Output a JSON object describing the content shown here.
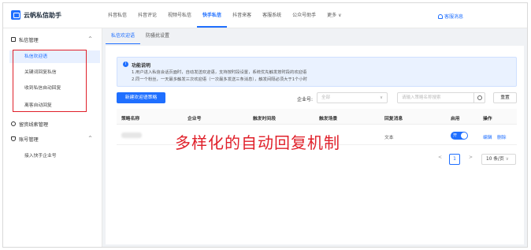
{
  "brand": {
    "name": "云帆私信助手",
    "logo_icon": "chat-app-logo"
  },
  "nav": {
    "items": [
      "抖音私信",
      "抖音评论",
      "视频号私信",
      "快手私信",
      "抖音来客",
      "客服系统",
      "公众号助手"
    ],
    "active": "快手私信",
    "more_label": "更多",
    "messages_label": "客服消息"
  },
  "sidebar": {
    "groups": [
      {
        "label": "私信管理",
        "expanded": true,
        "icon": "message-icon"
      },
      {
        "label": "留资线索管理",
        "icon": "clue-icon"
      },
      {
        "label": "账号管理",
        "expanded": true,
        "icon": "account-icon"
      }
    ],
    "items": [
      "私信欢迎语",
      "关键词回复私信",
      "收到私信自动回复",
      "离客自动回复",
      "接入快手企业号"
    ],
    "active": "私信欢迎语"
  },
  "tabs": [
    "私信欢迎语",
    "防骚扰设置"
  ],
  "active_tab": "私信欢迎语",
  "notice": {
    "title": "功能说明",
    "lines": [
      "1.用户进入私信会话页面时，自动发送欢迎语，支持按时段设置，系统优先触发按时段的欢迎语",
      "2.同一个粉丝，一天最多触发三次欢迎语（一次最多发送三条消息），触发间隔必须大于1个小时"
    ]
  },
  "toolbar": {
    "new_button": "新建欢迎语策略",
    "enterprise_label": "企业号:",
    "enterprise_select": "全部",
    "search_placeholder": "请输入策略名称搜索",
    "reset_button": "重置"
  },
  "table": {
    "headers": [
      "策略名称",
      "企业号",
      "触发时间段",
      "触发场景",
      "回复消息",
      "启用",
      "操作"
    ],
    "row": {
      "reply": "文本",
      "toggle_label": "开",
      "enabled": true,
      "edit": "编辑",
      "delete": "删除"
    }
  },
  "overlay_text": "多样化的自动回复机制",
  "pagination": {
    "prev": "<",
    "current": "1",
    "next": ">",
    "page_size": "10 条/页"
  },
  "colors": {
    "accent": "#1f6fff",
    "highlight": "#e0202a"
  }
}
